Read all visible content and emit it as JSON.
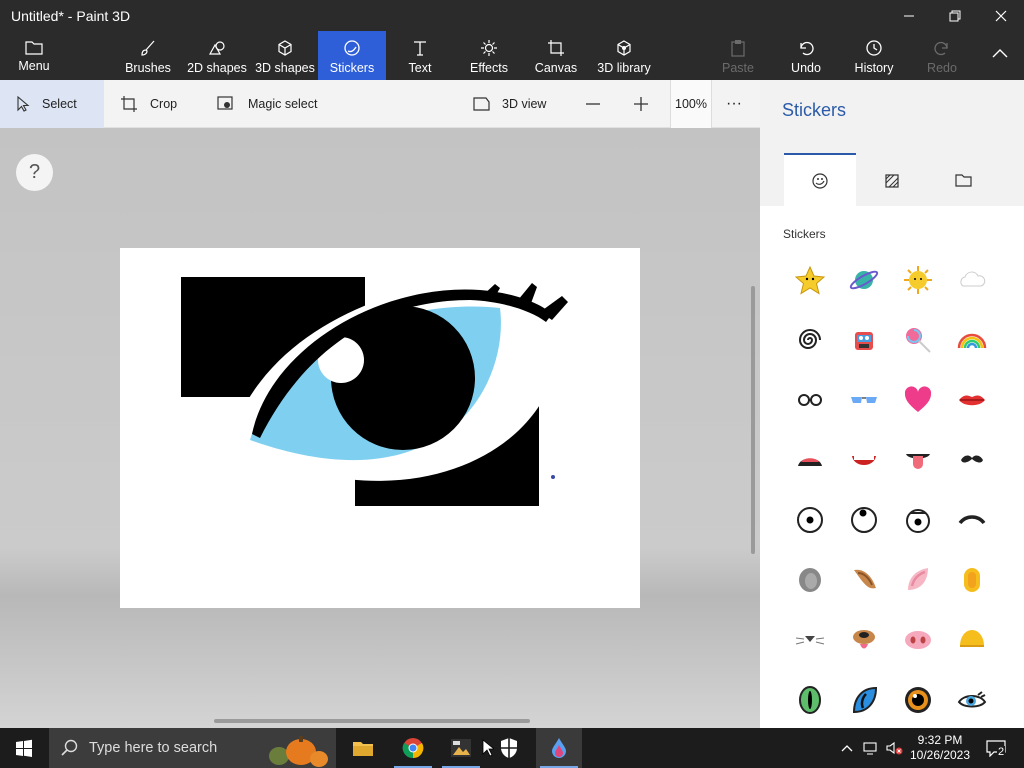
{
  "window": {
    "title": "Untitled* - Paint 3D"
  },
  "ribbon": {
    "menu": "Menu",
    "brushes": "Brushes",
    "shapes2d": "2D shapes",
    "shapes3d": "3D shapes",
    "stickers": "Stickers",
    "text": "Text",
    "effects": "Effects",
    "canvas": "Canvas",
    "library3d": "3D library",
    "paste": "Paste",
    "undo": "Undo",
    "history": "History",
    "redo": "Redo"
  },
  "toolbar": {
    "select": "Select",
    "crop": "Crop",
    "magic_select": "Magic select",
    "view3d": "3D view",
    "zoom": "100%",
    "more": "···"
  },
  "help": "?",
  "panel": {
    "title": "Stickers",
    "section_label": "Stickers",
    "tabs": [
      "sticker-tab-icon",
      "texture-tab-icon",
      "custom-sticker-tab-icon"
    ],
    "stickers": [
      "star",
      "planet",
      "sun",
      "cloud",
      "spiral",
      "robot",
      "lollipop",
      "rainbow",
      "glasses",
      "sunglasses",
      "heart",
      "lips",
      "open-mouth",
      "teeth-mouth",
      "tongue-mouth",
      "mustache",
      "eye-centered",
      "eye-looking-up",
      "eye-sad",
      "eyebrow",
      "gray-ear",
      "dog-ear",
      "pig-ear",
      "yellow-ear",
      "cat-nose",
      "dog-nose",
      "pig-nose",
      "duck-beak",
      "green-cat-eye",
      "blue-cat-eye",
      "amber-eye",
      "lashed-eye"
    ]
  },
  "taskbar": {
    "search_placeholder": "Type here to search",
    "time": "9:32 PM",
    "date": "10/26/2023",
    "notifications": "2"
  },
  "colors": {
    "accent": "#2e5fd9",
    "panel_title": "#2b5ba8",
    "eye_iris": "#7fd0f0"
  }
}
